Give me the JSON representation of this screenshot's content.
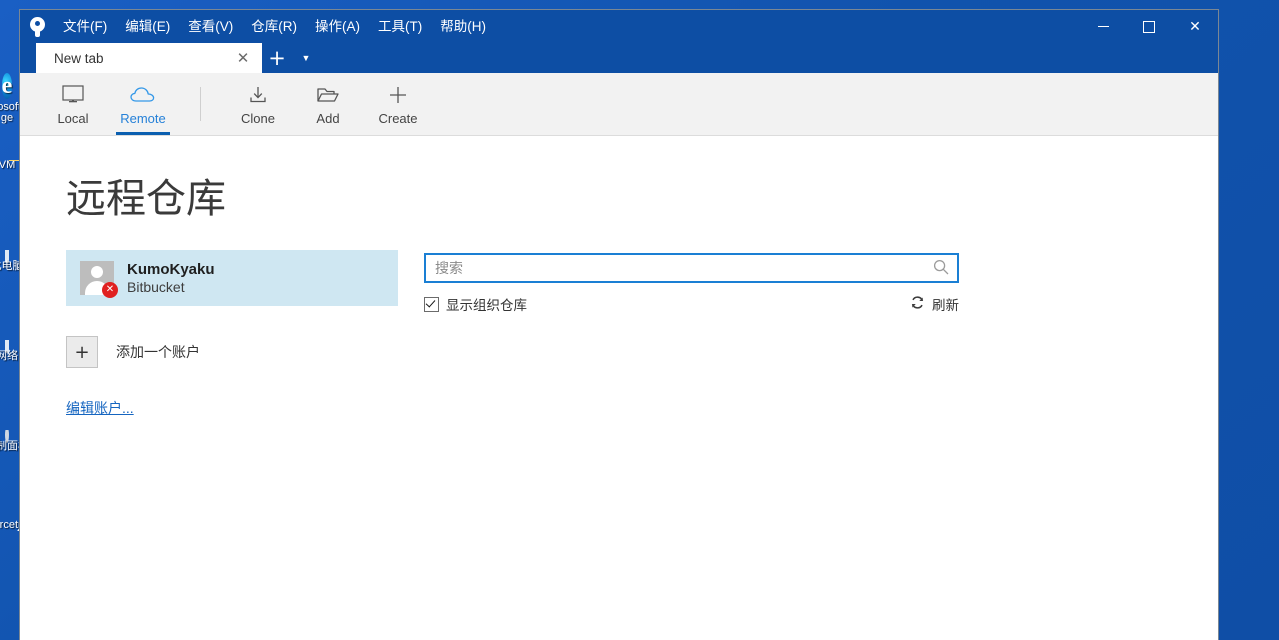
{
  "desktop": {
    "icons": [
      {
        "name": "microsoft-edge",
        "label": "Microsoft Edge"
      },
      {
        "name": "vm-folder",
        "label": "VM"
      },
      {
        "name": "this-pc",
        "label": "此电脑"
      },
      {
        "name": "network",
        "label": "网络"
      },
      {
        "name": "control-panel",
        "label": "控制面板"
      },
      {
        "name": "sourcetree",
        "label": "Sourcetree"
      }
    ]
  },
  "window": {
    "app": "Sourcetree",
    "titlebar_color": "#0d4ea4",
    "menus": [
      {
        "label": "文件(F)"
      },
      {
        "label": "编辑(E)"
      },
      {
        "label": "查看(V)"
      },
      {
        "label": "仓库(R)"
      },
      {
        "label": "操作(A)"
      },
      {
        "label": "工具(T)"
      },
      {
        "label": "帮助(H)"
      }
    ],
    "controls": {
      "minimize": "minimize-icon",
      "maximize": "maximize-icon",
      "close": "✕"
    }
  },
  "tabs": {
    "items": [
      {
        "label": "New tab",
        "close": "✕",
        "active": true
      }
    ],
    "new_tab": "+",
    "tab_list_menu": "▼"
  },
  "toolbar": {
    "accent": "#2681d8",
    "left_group": [
      {
        "label": "Local",
        "icon": "monitor-icon",
        "active": false
      },
      {
        "label": "Remote",
        "icon": "cloud-icon",
        "active": true
      }
    ],
    "right_group": [
      {
        "label": "Clone",
        "icon": "download-icon"
      },
      {
        "label": "Add",
        "icon": "folder-open-icon"
      },
      {
        "label": "Create",
        "icon": "plus-icon"
      }
    ]
  },
  "main": {
    "title": "远程仓库",
    "accounts": [
      {
        "name": "KumoKyaku",
        "host": "Bitbucket",
        "status": "error",
        "badge": "✕",
        "selected": true
      }
    ],
    "add_account": {
      "button": "+",
      "label": "添加一个账户"
    },
    "edit_account_link": "编辑账户...",
    "search": {
      "value": "",
      "placeholder": "搜索",
      "icon": "search-icon",
      "focused": true
    },
    "show_org_repos": {
      "label": "显示组织仓库",
      "checked": true
    },
    "refresh": {
      "label": "刷新",
      "icon": "refresh-icon"
    }
  }
}
